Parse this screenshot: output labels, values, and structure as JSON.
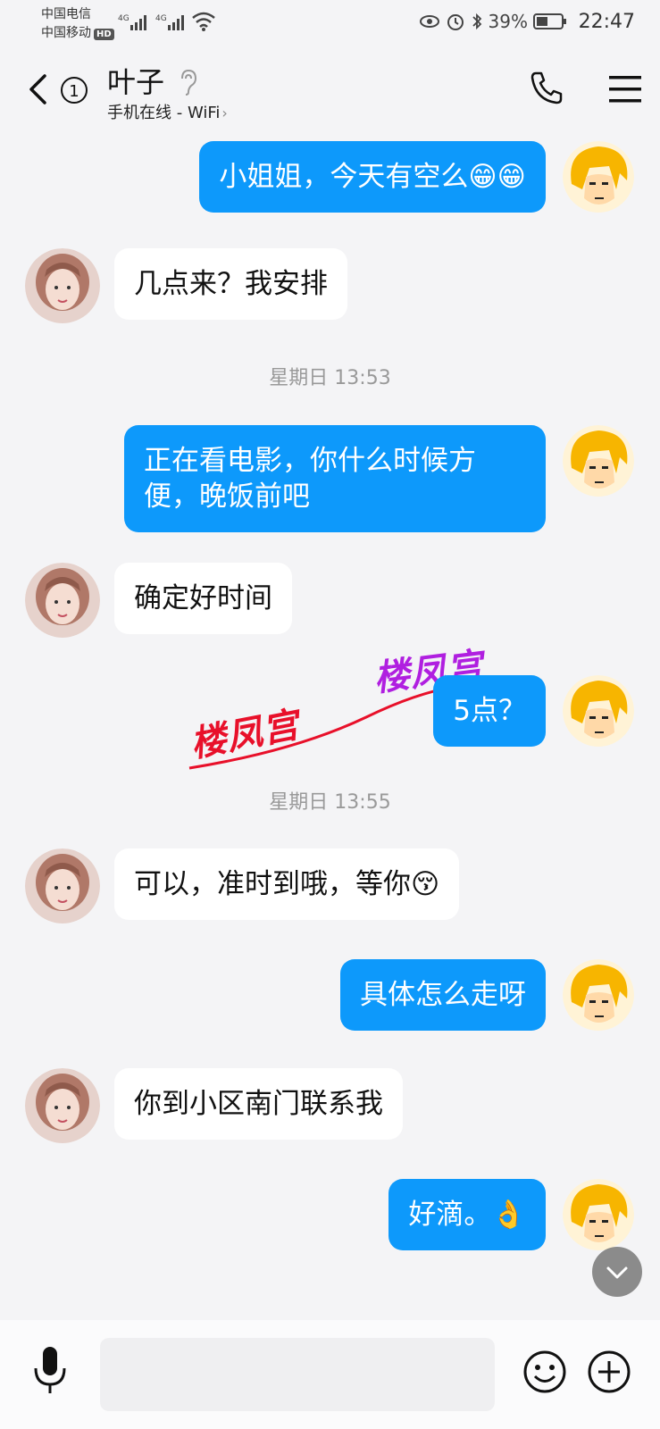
{
  "status_bar": {
    "carrier_1": "中国电信",
    "carrier_2": "中国移动",
    "hd": "HD",
    "net_1": "4G",
    "net_2": "4G",
    "battery": "39%",
    "time": "22:47"
  },
  "header": {
    "unread_count": "1",
    "contact_name": "叶子",
    "presence": "手机在线 - WiFi",
    "presence_arrow": "›"
  },
  "messages": [
    {
      "dir": "out",
      "text": "小姐姐，今天有空么😁😁"
    },
    {
      "dir": "in",
      "text": "几点来？我安排"
    },
    {
      "timestamp": "星期日 13:53"
    },
    {
      "dir": "out",
      "text": "正在看电影，你什么时候方便，晚饭前吧"
    },
    {
      "dir": "in",
      "text": "确定好时间"
    },
    {
      "dir": "out",
      "text": "5点？"
    },
    {
      "timestamp": "星期日 13:55"
    },
    {
      "dir": "in",
      "text": "可以，准时到哦，等你😚"
    },
    {
      "dir": "out",
      "text": "具体怎么走呀"
    },
    {
      "dir": "in",
      "text": "你到小区南门联系我"
    },
    {
      "dir": "out",
      "text": "好滴。👌"
    }
  ],
  "watermark": {
    "text_1": "楼凤宫",
    "text_2": "楼凤宫"
  },
  "composer": {
    "placeholder": ""
  },
  "colors": {
    "outgoing_bubble": "#0d99fb",
    "incoming_bubble": "#ffffff",
    "background": "#f4f4f6"
  }
}
